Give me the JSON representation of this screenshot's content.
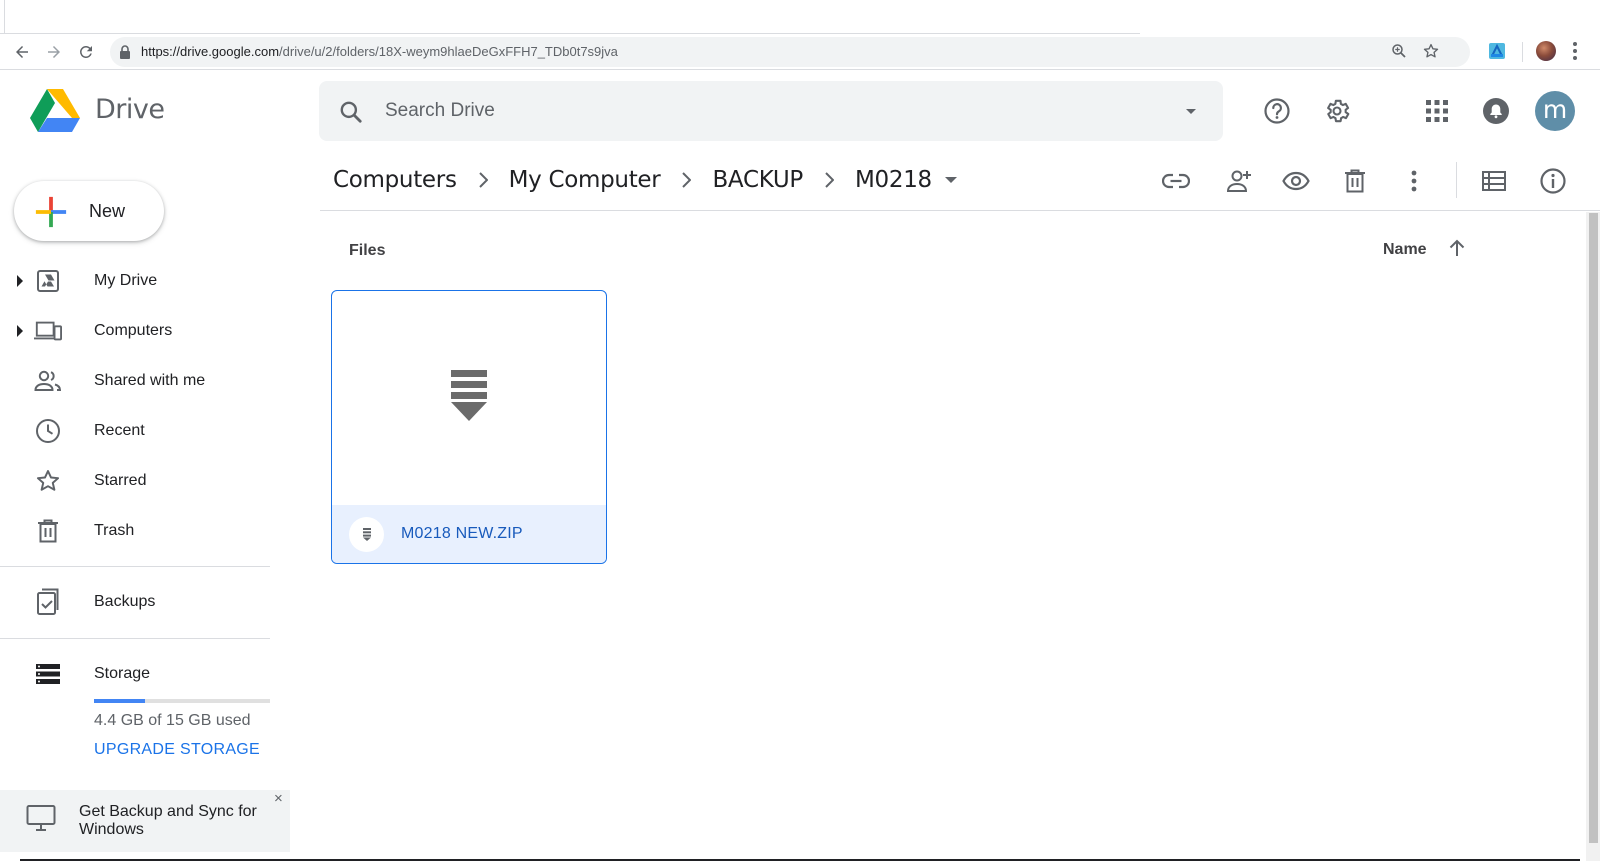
{
  "browser": {
    "url_host": "https://drive.google.com",
    "url_path": "/drive/u/2/folders/18X-weym9hlaeDeGxFFH7_TDb0t7s9jva"
  },
  "app": {
    "name": "Drive"
  },
  "search": {
    "placeholder": "Search Drive"
  },
  "account": {
    "avatar_letter": "m",
    "avatar_color": "#5f8ea8"
  },
  "sidebar": {
    "new_label": "New",
    "items": [
      {
        "label": "My Drive",
        "icon": "my-drive-icon",
        "expandable": true
      },
      {
        "label": "Computers",
        "icon": "computers-icon",
        "expandable": true
      },
      {
        "label": "Shared with me",
        "icon": "shared-people-icon",
        "expandable": false
      },
      {
        "label": "Recent",
        "icon": "clock-icon",
        "expandable": false
      },
      {
        "label": "Starred",
        "icon": "star-icon",
        "expandable": false
      },
      {
        "label": "Trash",
        "icon": "trash-icon",
        "expandable": false
      },
      {
        "label": "Backups",
        "icon": "backup-icon",
        "expandable": false
      },
      {
        "label": "Storage",
        "icon": "storage-icon",
        "expandable": false
      }
    ],
    "storage": {
      "used_fraction": 0.29,
      "text": "4.4 GB of 15 GB used",
      "upgrade_label": "UPGRADE STORAGE"
    },
    "promo": {
      "text": "Get Backup and Sync for Windows",
      "close": "×"
    }
  },
  "breadcrumb": [
    "Computers",
    "My Computer",
    "BACKUP",
    "M0218"
  ],
  "actions": [
    "link-icon",
    "share-person-add-icon",
    "preview-eye-icon",
    "delete-trash-icon",
    "more-vert-icon",
    "list-view-icon",
    "info-icon"
  ],
  "files": {
    "section_label": "Files",
    "sort_label": "Name",
    "items": [
      {
        "name": "M0218 NEW.ZIP",
        "type": "zip-archive",
        "selected": true
      }
    ]
  },
  "colors": {
    "accent": "#1a73e8",
    "selected_bg": "#e8f0fe"
  }
}
